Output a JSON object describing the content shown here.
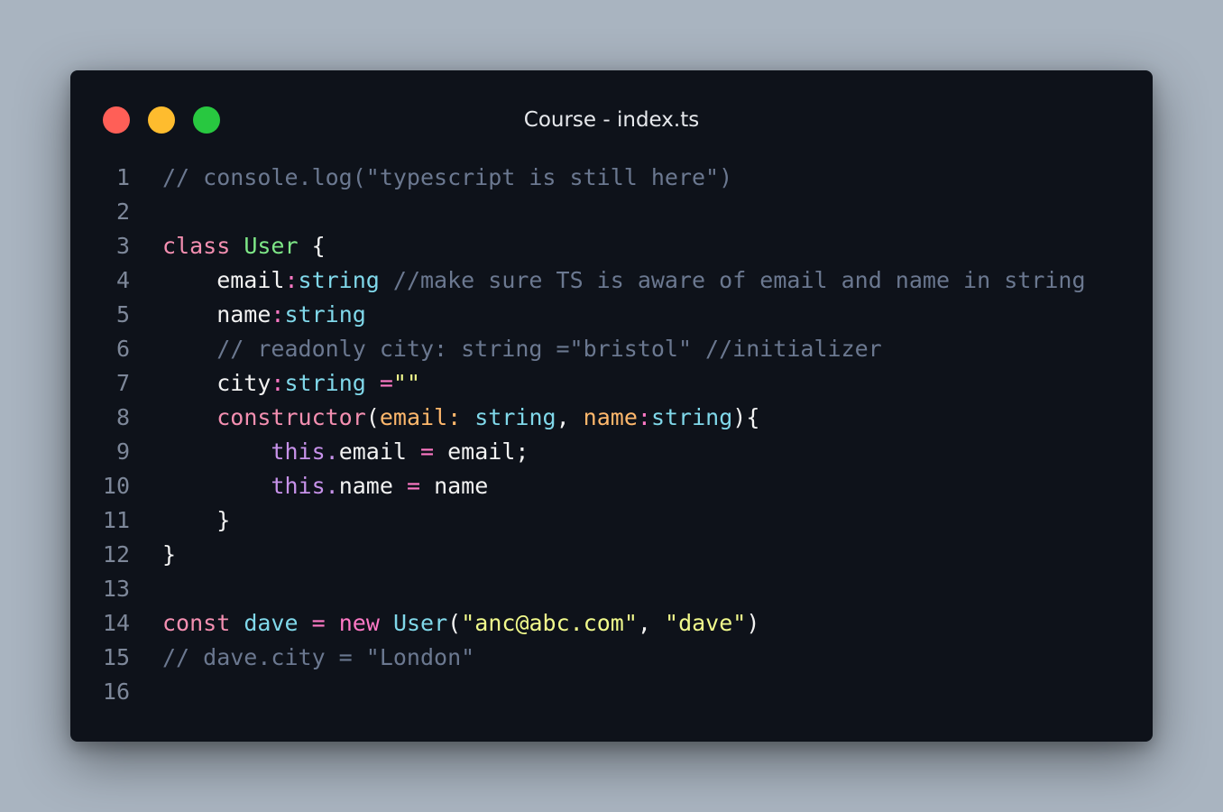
{
  "window": {
    "title": "Course - index.ts",
    "traffic_lights": [
      {
        "name": "close",
        "color": "#ff5f57"
      },
      {
        "name": "minimize",
        "color": "#febc2e"
      },
      {
        "name": "zoom",
        "color": "#28c840"
      }
    ]
  },
  "code": {
    "language": "typescript",
    "lines": [
      {
        "number": "1",
        "tokens": [
          {
            "text": "// console.log(\"typescript is still here\")",
            "kind": "comment"
          }
        ]
      },
      {
        "number": "2",
        "tokens": []
      },
      {
        "number": "3",
        "tokens": [
          {
            "text": "class",
            "kind": "keyword"
          },
          {
            "text": " ",
            "kind": "plain"
          },
          {
            "text": "User",
            "kind": "classname"
          },
          {
            "text": " {",
            "kind": "punct"
          }
        ]
      },
      {
        "number": "4",
        "tokens": [
          {
            "text": "    email",
            "kind": "plain"
          },
          {
            "text": ":",
            "kind": "colon"
          },
          {
            "text": "string",
            "kind": "type"
          },
          {
            "text": " ",
            "kind": "plain"
          },
          {
            "text": "//make sure TS is aware of email and name in string",
            "kind": "comment"
          }
        ]
      },
      {
        "number": "5",
        "tokens": [
          {
            "text": "    name",
            "kind": "plain"
          },
          {
            "text": ":",
            "kind": "colon"
          },
          {
            "text": "string",
            "kind": "type"
          }
        ]
      },
      {
        "number": "6",
        "tokens": [
          {
            "text": "    // readonly city: string =\"bristol\" //initializer",
            "kind": "comment"
          }
        ]
      },
      {
        "number": "7",
        "tokens": [
          {
            "text": "    city",
            "kind": "plain"
          },
          {
            "text": ":",
            "kind": "colon"
          },
          {
            "text": "string",
            "kind": "type"
          },
          {
            "text": " ",
            "kind": "plain"
          },
          {
            "text": "=",
            "kind": "op"
          },
          {
            "text": "\"\"",
            "kind": "string"
          }
        ]
      },
      {
        "number": "8",
        "tokens": [
          {
            "text": "    ",
            "kind": "plain"
          },
          {
            "text": "constructor",
            "kind": "keyword"
          },
          {
            "text": "(",
            "kind": "punct"
          },
          {
            "text": "email",
            "kind": "param"
          },
          {
            "text": ":",
            "kind": "param"
          },
          {
            "text": " ",
            "kind": "plain"
          },
          {
            "text": "string",
            "kind": "type"
          },
          {
            "text": ", ",
            "kind": "punct"
          },
          {
            "text": "name",
            "kind": "param"
          },
          {
            "text": ":",
            "kind": "colon"
          },
          {
            "text": "string",
            "kind": "type"
          },
          {
            "text": "){",
            "kind": "punct"
          }
        ]
      },
      {
        "number": "9",
        "tokens": [
          {
            "text": "        ",
            "kind": "plain"
          },
          {
            "text": "this",
            "kind": "this"
          },
          {
            "text": ".",
            "kind": "this"
          },
          {
            "text": "email ",
            "kind": "plain"
          },
          {
            "text": "=",
            "kind": "op"
          },
          {
            "text": " email;",
            "kind": "plain"
          }
        ]
      },
      {
        "number": "10",
        "tokens": [
          {
            "text": "        ",
            "kind": "plain"
          },
          {
            "text": "this",
            "kind": "this"
          },
          {
            "text": ".",
            "kind": "this"
          },
          {
            "text": "name ",
            "kind": "plain"
          },
          {
            "text": "=",
            "kind": "op"
          },
          {
            "text": " name",
            "kind": "plain"
          }
        ]
      },
      {
        "number": "11",
        "tokens": [
          {
            "text": "    }",
            "kind": "punct"
          }
        ]
      },
      {
        "number": "12",
        "tokens": [
          {
            "text": "}",
            "kind": "punct"
          }
        ]
      },
      {
        "number": "13",
        "tokens": []
      },
      {
        "number": "14",
        "tokens": [
          {
            "text": "const",
            "kind": "keyword"
          },
          {
            "text": " ",
            "kind": "plain"
          },
          {
            "text": "dave",
            "kind": "type"
          },
          {
            "text": " ",
            "kind": "plain"
          },
          {
            "text": "=",
            "kind": "op"
          },
          {
            "text": " ",
            "kind": "plain"
          },
          {
            "text": "new",
            "kind": "new"
          },
          {
            "text": " ",
            "kind": "plain"
          },
          {
            "text": "User",
            "kind": "type"
          },
          {
            "text": "(",
            "kind": "punct"
          },
          {
            "text": "\"anc@abc.com\"",
            "kind": "string"
          },
          {
            "text": ", ",
            "kind": "punct"
          },
          {
            "text": "\"dave\"",
            "kind": "string"
          },
          {
            "text": ")",
            "kind": "punct"
          }
        ]
      },
      {
        "number": "15",
        "tokens": [
          {
            "text": "// dave.city = \"London\"",
            "kind": "comment"
          }
        ]
      },
      {
        "number": "16",
        "tokens": []
      }
    ]
  }
}
